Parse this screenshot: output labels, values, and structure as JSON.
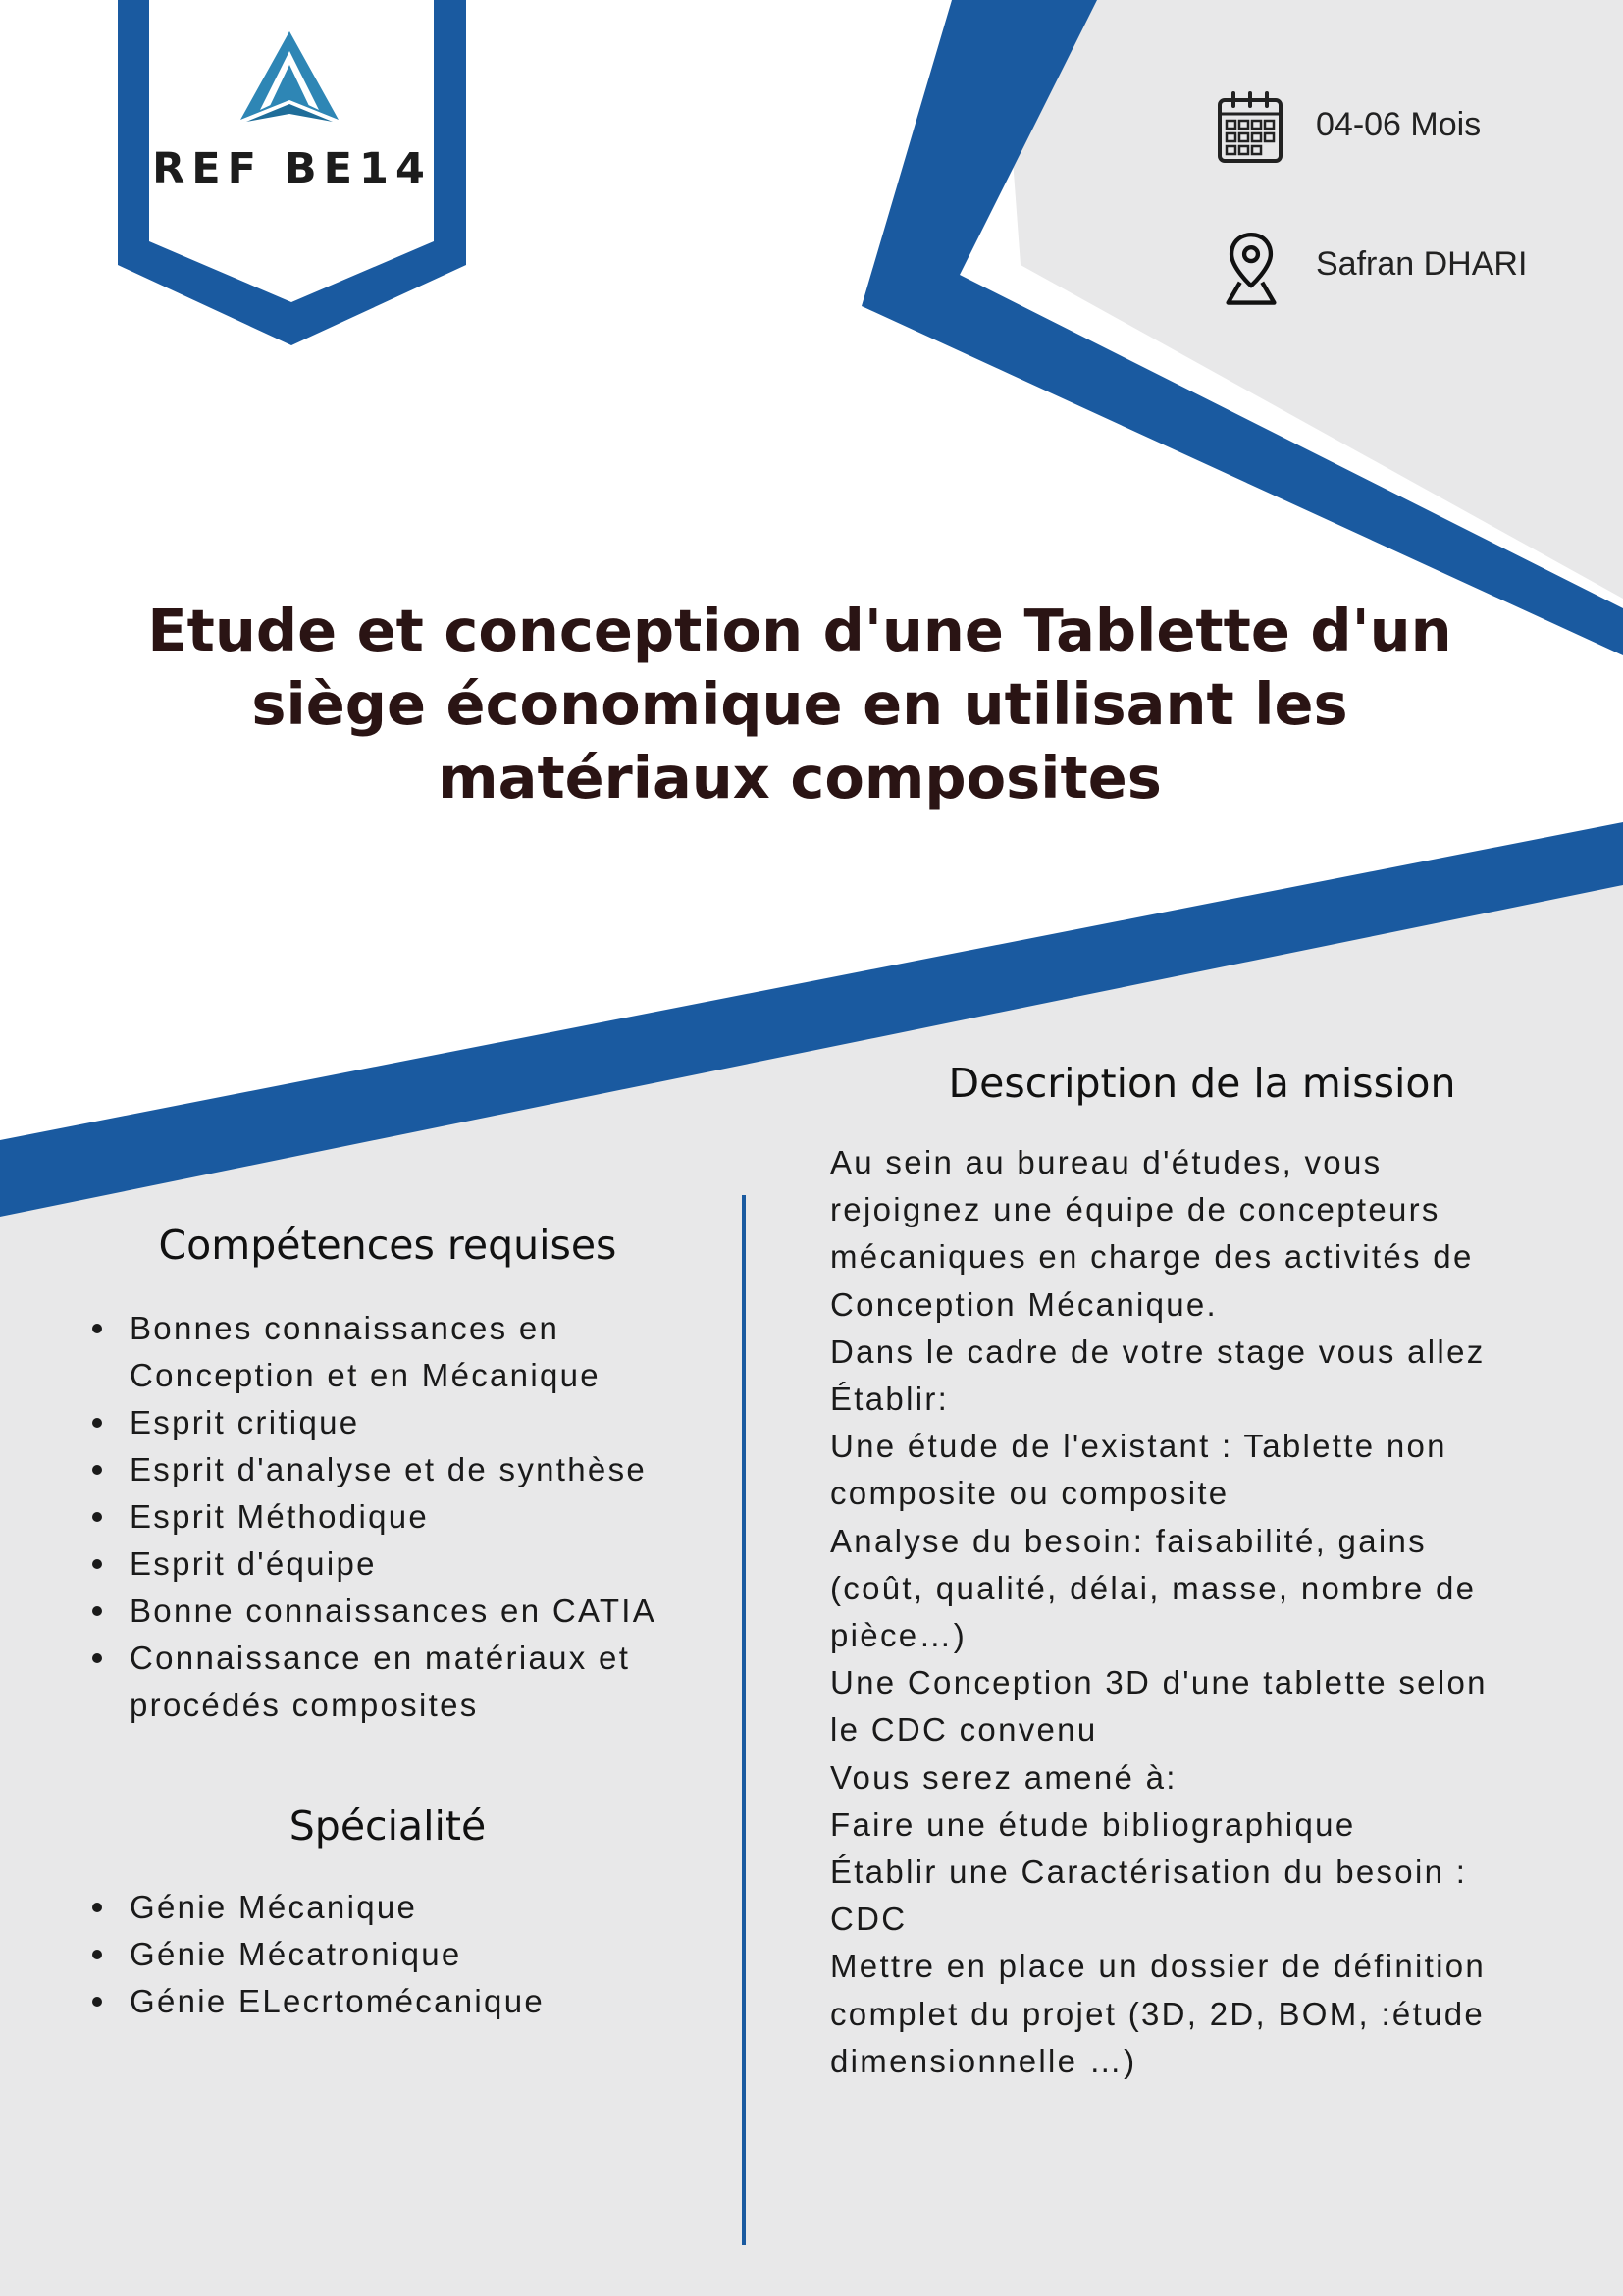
{
  "ref": {
    "code": "REF BE14"
  },
  "info": {
    "duration": "04-06 Mois",
    "location": "Safran DHARI"
  },
  "title_lines": [
    "Etude et conception d'une Tablette d'un",
    "siège économique en utilisant les",
    "matériaux composites"
  ],
  "competences": {
    "heading": "Compétences requises",
    "items": [
      [
        "Bonnes connaissances en",
        "Conception et en Mécanique"
      ],
      [
        "Esprit critique"
      ],
      [
        "Esprit d'analyse et de synthèse"
      ],
      [
        "Esprit Méthodique"
      ],
      [
        "Esprit d'équipe"
      ],
      [
        "Bonne connaissances en CATIA"
      ],
      [
        "Connaissance en matériaux et",
        "procédés composites"
      ]
    ]
  },
  "specialite": {
    "heading": "Spécialité",
    "items": [
      "Génie Mécanique",
      "Génie Mécatronique",
      "Génie ELecrtomécanique"
    ]
  },
  "description": {
    "heading": "Description de la mission",
    "lines": [
      "Au sein au bureau d'études, vous",
      "rejoignez une équipe de concepteurs",
      "mécaniques en charge des activités de",
      "Conception Mécanique.",
      "Dans le cadre de votre stage vous allez",
      "Établir:",
      "Une étude de l'existant : Tablette non",
      "composite ou composite",
      "Analyse du besoin: faisabilité, gains",
      "(coût, qualité, délai, masse, nombre de",
      "pièce…)",
      "Une Conception 3D d'une tablette selon",
      "le CDC convenu",
      "Vous serez amené à:",
      "Faire une étude bibliographique",
      "Établir une Caractérisation du besoin :",
      "CDC",
      "Mettre en place un dossier de définition",
      "complet du projet (3D, 2D, BOM, :étude",
      "dimensionnelle …)"
    ]
  },
  "colors": {
    "accent_blue": "#1a5aa0",
    "panel_gray": "#e8e8e9",
    "title_dark": "#2a1414",
    "logo_teal": "#2e86b5"
  }
}
